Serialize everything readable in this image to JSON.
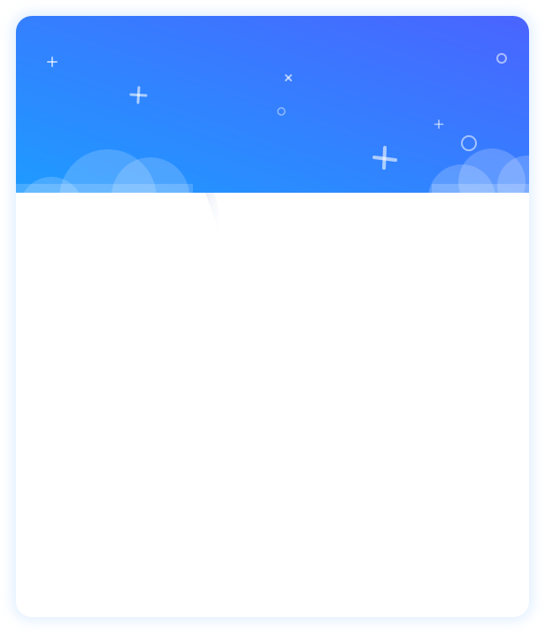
{
  "card": {
    "banner": {
      "gradient_start": "#1E9BFF",
      "gradient_end": "#4A64FF",
      "decoration_color": "#FFFFFF"
    },
    "body": {
      "background": "#FFFFFF"
    }
  }
}
